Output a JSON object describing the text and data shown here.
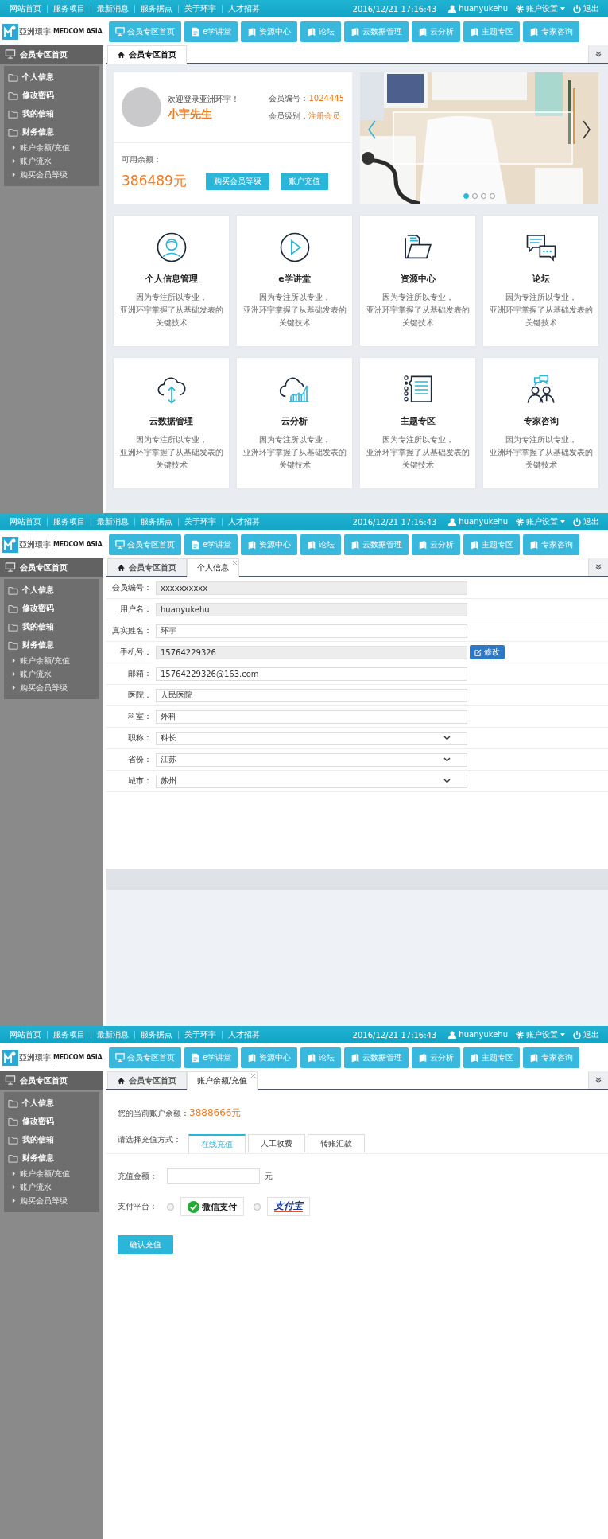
{
  "screens": [
    {
      "top_bar": {
        "links": [
          "网站首页",
          "服务项目",
          "最新消息",
          "服务据点",
          "关于环宇",
          "人才招募"
        ],
        "datetime": "2016/12/21 17:16:43",
        "user": "huanyukehu",
        "settings": "账户设置",
        "logout": "退出"
      },
      "header": {
        "logo_cn": "亞洲環宇",
        "logo_en": "MEDCOM ASIA",
        "nav": [
          "会员专区首页",
          "e学讲堂",
          "资源中心",
          "论坛",
          "云数据管理",
          "云分析",
          "主题专区",
          "专家咨询"
        ]
      },
      "sidebar": {
        "title": "会员专区首页",
        "items": [
          {
            "label": "个人信息"
          },
          {
            "label": "修改密码"
          },
          {
            "label": "我的信箱"
          },
          {
            "label": "财务信息",
            "children": [
              {
                "label": "账户余额/充值"
              },
              {
                "label": "账户流水"
              },
              {
                "label": "购买会员等级"
              }
            ]
          }
        ]
      },
      "tabs": [
        {
          "label": "会员专区首页",
          "selected": true,
          "closable": false
        }
      ],
      "content": {
        "kind": "dashboard",
        "member": {
          "welcome": "欢迎登录亚洲环宇！",
          "name": "小宇先生",
          "id_label": "会员编号：",
          "id": "1024445",
          "level_label": "会员级别：",
          "level": "注册会员",
          "balance_label": "可用余额：",
          "balance": "386489元",
          "buttons": [
            "购买会员等级",
            "账户充值"
          ]
        },
        "banner": {
          "kind": "picture",
          "dots": [
            {
              "selected": true
            },
            {
              "selected": false
            },
            {
              "selected": false
            },
            {
              "selected": false
            }
          ]
        },
        "cards": [
          {
            "title": "个人信息管理",
            "lines": [
              "因为专注所以专业，",
              "亚洲环宇掌握了从基础发表的关键技术"
            ]
          },
          {
            "title": "e学讲堂",
            "lines": [
              "因为专注所以专业，",
              "亚洲环宇掌握了从基础发表的关键技术"
            ]
          },
          {
            "title": "资源中心",
            "lines": [
              "因为专注所以专业，",
              "亚洲环宇掌握了从基础发表的关键技术"
            ]
          },
          {
            "title": "论坛",
            "lines": [
              "因为专注所以专业，",
              "亚洲环宇掌握了从基础发表的关键技术"
            ]
          },
          {
            "title": "云数据管理",
            "lines": [
              "因为专注所以专业，",
              "亚洲环宇掌握了从基础发表的关键技术"
            ]
          },
          {
            "title": "云分析",
            "lines": [
              "因为专注所以专业，",
              "亚洲环宇掌握了从基础发表的关键技术"
            ]
          },
          {
            "title": "主题专区",
            "lines": [
              "因为专注所以专业，",
              "亚洲环宇掌握了从基础发表的关键技术"
            ]
          },
          {
            "title": "专家咨询",
            "lines": [
              "因为专注所以专业，",
              "亚洲环宇掌握了从基础发表的关键技术"
            ]
          }
        ]
      }
    },
    {
      "top_bar": {
        "links": [
          "网站首页",
          "服务项目",
          "最新消息",
          "服务据点",
          "关于环宇",
          "人才招募"
        ],
        "datetime": "2016/12/21 17:16:43",
        "user": "huanyukehu",
        "settings": "账户设置",
        "logout": "退出"
      },
      "header": {
        "logo_cn": "亞洲環宇",
        "logo_en": "MEDCOM ASIA",
        "nav": [
          "会员专区首页",
          "e学讲堂",
          "资源中心",
          "论坛",
          "云数据管理",
          "云分析",
          "主题专区",
          "专家咨询"
        ]
      },
      "sidebar": {
        "title": "会员专区首页",
        "items": [
          {
            "label": "个人信息"
          },
          {
            "label": "修改密码"
          },
          {
            "label": "我的信箱"
          },
          {
            "label": "财务信息",
            "children": [
              {
                "label": "账户余额/充值"
              },
              {
                "label": "账户流水"
              },
              {
                "label": "购买会员等级"
              }
            ]
          }
        ]
      },
      "tabs": [
        {
          "label": "会员专区首页",
          "selected": false,
          "closable": false
        },
        {
          "label": "个人信息",
          "selected": true,
          "closable": true
        }
      ],
      "content": {
        "kind": "form",
        "fields": [
          {
            "label": "会员编号：",
            "value": "xxxxxxxxxx",
            "kind": "text",
            "disabled": true
          },
          {
            "label": "用户名：",
            "value": "huanyukehu",
            "kind": "text",
            "disabled": true
          },
          {
            "label": "真实姓名：",
            "value": "环宇",
            "kind": "text",
            "disabled": false
          },
          {
            "label": "手机号：",
            "value": "15764229326",
            "kind": "text",
            "disabled": true,
            "button": "修改"
          },
          {
            "label": "邮箱：",
            "value": "15764229326@163.com",
            "kind": "text",
            "disabled": false
          },
          {
            "label": "医院：",
            "value": "人民医院",
            "kind": "text",
            "disabled": false
          },
          {
            "label": "科室：",
            "value": "外科",
            "kind": "text",
            "disabled": false
          },
          {
            "label": "职称：",
            "value": "科长",
            "kind": "select",
            "disabled": false
          },
          {
            "label": "省份：",
            "value": "江苏",
            "kind": "select",
            "disabled": false
          },
          {
            "label": "城市：",
            "value": "苏州",
            "kind": "select",
            "disabled": false
          }
        ]
      }
    },
    {
      "top_bar": {
        "links": [
          "网站首页",
          "服务项目",
          "最新消息",
          "服务据点",
          "关于环宇",
          "人才招募"
        ],
        "datetime": "2016/12/21 17:16:43",
        "user": "huanyukehu",
        "settings": "账户设置",
        "logout": "退出"
      },
      "header": {
        "logo_cn": "亞洲環宇",
        "logo_en": "MEDCOM ASIA",
        "nav": [
          "会员专区首页",
          "e学讲堂",
          "资源中心",
          "论坛",
          "云数据管理",
          "云分析",
          "主题专区",
          "专家咨询"
        ]
      },
      "sidebar": {
        "title": "会员专区首页",
        "items": [
          {
            "label": "个人信息"
          },
          {
            "label": "修改密码"
          },
          {
            "label": "我的信箱"
          },
          {
            "label": "财务信息",
            "children": [
              {
                "label": "账户余额/充值"
              },
              {
                "label": "账户流水"
              },
              {
                "label": "购买会员等级"
              }
            ]
          }
        ]
      },
      "tabs": [
        {
          "label": "会员专区首页",
          "selected": false,
          "closable": false
        },
        {
          "label": "账户余额/充值",
          "selected": true,
          "closable": true
        }
      ],
      "content": {
        "kind": "recharge",
        "balance_label": "您的当前账户余额：",
        "balance": "3888666元",
        "method_label": "请选择充值方式：",
        "methods": [
          {
            "label": "在线充值",
            "selected": true
          },
          {
            "label": "人工收费",
            "selected": false
          },
          {
            "label": "转账汇款",
            "selected": false
          }
        ],
        "amount_label": "充值金额：",
        "amount_unit": "元",
        "platform_label": "支付平台：",
        "platforms": [
          {
            "kind": "wechat",
            "label": "微信支付",
            "selected": false
          },
          {
            "kind": "alipay",
            "label": "支付宝",
            "selected": false
          }
        ],
        "submit": "确认充值"
      }
    }
  ]
}
